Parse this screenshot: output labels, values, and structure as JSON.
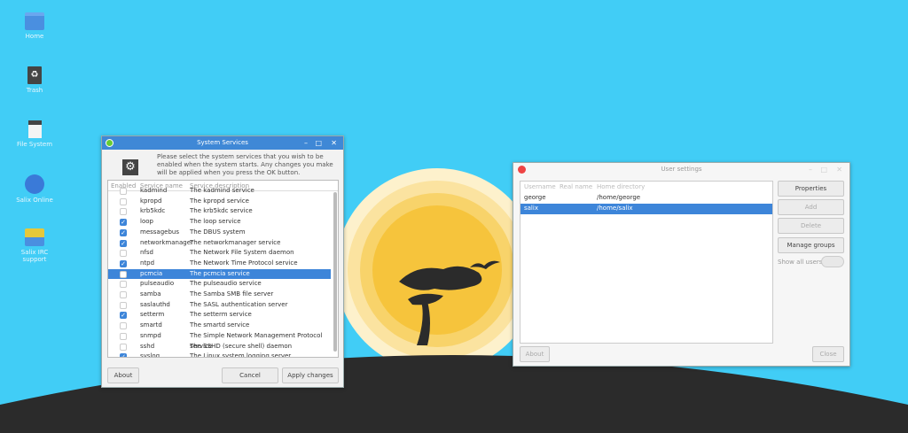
{
  "desktop": {
    "icons": [
      {
        "label": "Home",
        "icon": "folder-icon"
      },
      {
        "label": "Trash",
        "icon": "trash-icon"
      },
      {
        "label": "File System",
        "icon": "drive-icon"
      },
      {
        "label": "Salix Online",
        "icon": "globe-icon"
      },
      {
        "label": "Salix IRC support",
        "icon": "chat-icon"
      }
    ]
  },
  "services": {
    "title": "System Services",
    "description": "Please select the system services that you wish to be enabled when the system starts. Any changes you make will be applied when you press the OK button.",
    "columns": [
      "Enabled",
      "Service name",
      "Service description"
    ],
    "rows": [
      {
        "name": "kadmind",
        "desc": "The kadmind service",
        "on": false
      },
      {
        "name": "kpropd",
        "desc": "The kpropd service",
        "on": false
      },
      {
        "name": "krb5kdc",
        "desc": "The krb5kdc service",
        "on": false
      },
      {
        "name": "loop",
        "desc": "The loop service",
        "on": true
      },
      {
        "name": "messagebus",
        "desc": "The DBUS system",
        "on": true
      },
      {
        "name": "networkmanager",
        "desc": "The networkmanager service",
        "on": true
      },
      {
        "name": "nfsd",
        "desc": "The Network File System daemon",
        "on": false
      },
      {
        "name": "ntpd",
        "desc": "The Network Time Protocol service",
        "on": true
      },
      {
        "name": "pcmcia",
        "desc": "The pcmcia service",
        "on": false,
        "selected": true
      },
      {
        "name": "pulseaudio",
        "desc": "The pulseaudio service",
        "on": false
      },
      {
        "name": "samba",
        "desc": "The Samba SMB file server",
        "on": false
      },
      {
        "name": "saslauthd",
        "desc": "The SASL authentication server",
        "on": false
      },
      {
        "name": "setterm",
        "desc": "The setterm service",
        "on": true
      },
      {
        "name": "smartd",
        "desc": "The smartd service",
        "on": false
      },
      {
        "name": "snmpd",
        "desc": "The Simple Network Management Protocol service",
        "on": false
      },
      {
        "name": "sshd",
        "desc": "The SSHD (secure shell) daemon",
        "on": false
      },
      {
        "name": "syslog",
        "desc": "The Linux system logging server",
        "on": true
      }
    ],
    "about": "About",
    "cancel": "Cancel",
    "apply": "Apply changes"
  },
  "users": {
    "title": "User settings",
    "columns": [
      "Username",
      "Real name",
      "Home directory"
    ],
    "rows": [
      {
        "user": "george",
        "real": "",
        "home": "/home/george"
      },
      {
        "user": "salix",
        "real": "",
        "home": "/home/salix",
        "selected": true
      }
    ],
    "properties": "Properties",
    "add": "Add",
    "delete": "Delete",
    "manage": "Manage groups",
    "show_all": "Show all users",
    "show_all_on": false,
    "about": "About",
    "close": "Close"
  }
}
